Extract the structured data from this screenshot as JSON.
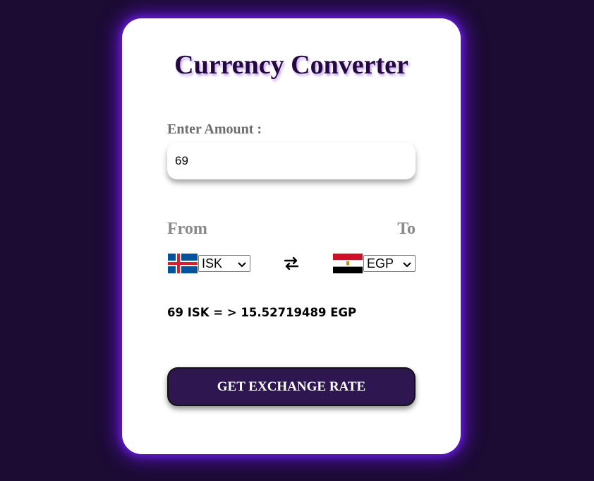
{
  "app": {
    "title": "Currency Converter"
  },
  "amount": {
    "label": "Enter Amount :",
    "value": "69"
  },
  "from": {
    "label": "From",
    "currency": "ISK",
    "flag": "iceland-flag"
  },
  "to": {
    "label": "To",
    "currency": "EGP",
    "flag": "egypt-flag"
  },
  "swap_icon": "swap-arrows-icon",
  "result": {
    "text": "69 ISK = > 15.52719489 EGP"
  },
  "button": {
    "label": "GET EXCHANGE RATE"
  },
  "colors": {
    "background": "#1c0b33",
    "card": "#ffffff",
    "glow": "#5b12c9",
    "button": "#2e1750",
    "title": "#24093f"
  }
}
